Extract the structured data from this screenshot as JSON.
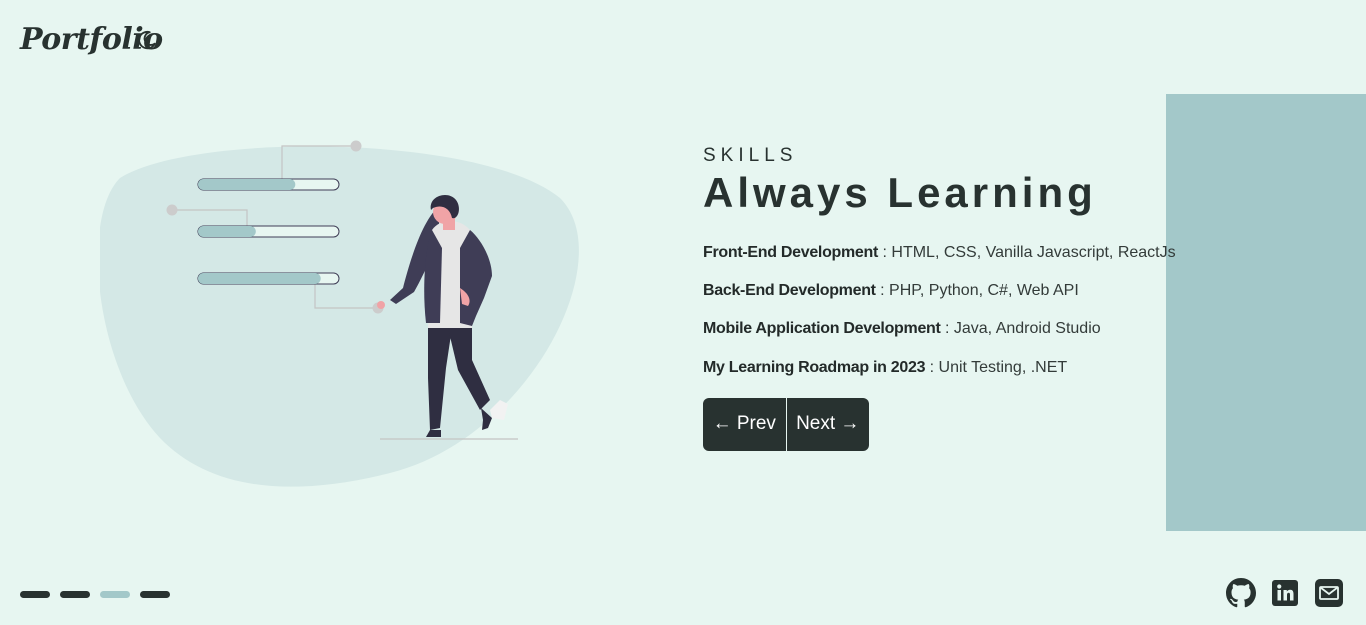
{
  "header": {
    "logo_text": "Portfolio",
    "theme_icon": "moon-icon"
  },
  "hero": {
    "eyebrow": "SKILLS",
    "heading": "Always Learning",
    "skills": [
      {
        "label": "Front-End Development",
        "value": " : HTML, CSS, Vanilla Javascript, ReactJs"
      },
      {
        "label": "Back-End Development",
        "value": " : PHP, Python, C#, Web API"
      },
      {
        "label": "Mobile Application Development",
        "value": " : Java, Android Studio"
      },
      {
        "label": "My Learning Roadmap in 2023",
        "value": " : Unit Testing, .NET"
      }
    ],
    "prev_label": "← Prev",
    "next_label": "Next →"
  },
  "illustration": {
    "progress_levels": [
      0.69,
      0.41,
      0.87
    ]
  },
  "pagination": {
    "count": 4,
    "active_index": 2
  },
  "social": {
    "icons": [
      "github-icon",
      "linkedin-icon",
      "email-icon"
    ]
  },
  "colors": {
    "background": "#e7f6f1",
    "accent": "#a3c8c9",
    "dark": "#283230",
    "blob": "#d4e8e6"
  }
}
